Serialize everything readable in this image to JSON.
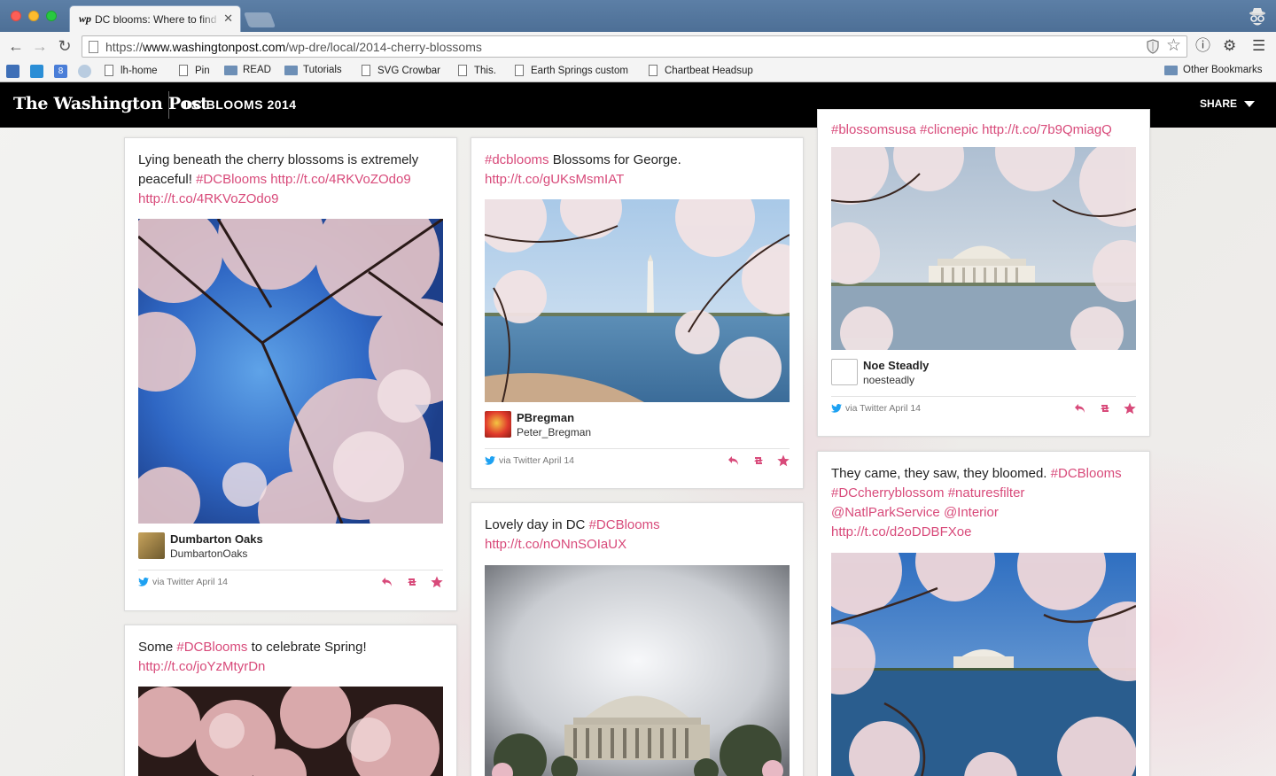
{
  "browser": {
    "tab_title": "DC blooms: Where to find cherry blossoms",
    "tab_favicon": "wp",
    "url_prefix": "https://",
    "url_host": "www.washingtonpost.com",
    "url_path": "/wp-dre/local/2014-cherry-blossoms",
    "bookmarks": [
      "lh-home",
      "Pin",
      "READ",
      "Tutorials",
      "SVG Crowbar",
      "This.",
      "Earth Springs custom",
      "Chartbeat Headsup"
    ],
    "other_bookmarks": "Other Bookmarks",
    "bookmark_badge": "8"
  },
  "header": {
    "logo": "The Washington Post",
    "section": "DC BLOOMS 2014",
    "share": "SHARE"
  },
  "cards": [
    {
      "text": "Lying beneath the cherry blossoms is extremely peaceful!",
      "links": [
        "#DCBlooms",
        "http://t.co/4RKVoZOdo9",
        "http://t.co/4RKVoZOdo9"
      ],
      "user_name": "Dumbarton Oaks",
      "user_handle": "DumbartonOaks",
      "via": "via Twitter April 14"
    },
    {
      "links_pre": "#dcblooms",
      "text": "Blossoms for George.",
      "links": [
        "http://t.co/gUKsMsmIAT"
      ],
      "user_name": "PBregman",
      "user_handle": "Peter_Bregman",
      "via": "via Twitter April 14"
    },
    {
      "text_top": "#blossomsusa #clicnepic http://t.co/7b9QmiagQ",
      "user_name": "Noe Steadly",
      "user_handle": "noesteadly",
      "via": "via Twitter April 14"
    },
    {
      "text": "Some",
      "links": [
        "#DCBlooms"
      ],
      "text_after": "to celebrate Spring!",
      "link_line2": "http://t.co/joYzMtyrDn"
    },
    {
      "text": "Lovely day in DC",
      "links": [
        "#DCBlooms"
      ],
      "link_line2": "http://t.co/nONnSOIaUX"
    },
    {
      "text": "They came, they saw, they bloomed.",
      "links": [
        "#DCBlooms",
        "#DCcherryblossom",
        "#naturesfilter",
        "@NatlParkService",
        "@Interior",
        "http://t.co/d2oDDBFXoe"
      ]
    }
  ],
  "colors": {
    "link": "#d84a7a",
    "header_bg": "#000000",
    "twitter_blue": "#1da1f2",
    "action_pink": "#d84a7a"
  },
  "icons": [
    "back-icon",
    "forward-icon",
    "reload-icon",
    "star-icon",
    "shield-icon",
    "settings-icon",
    "menu-icon",
    "incognito-icon",
    "twitter-icon",
    "reply-icon",
    "retweet-icon",
    "favorite-icon"
  ]
}
